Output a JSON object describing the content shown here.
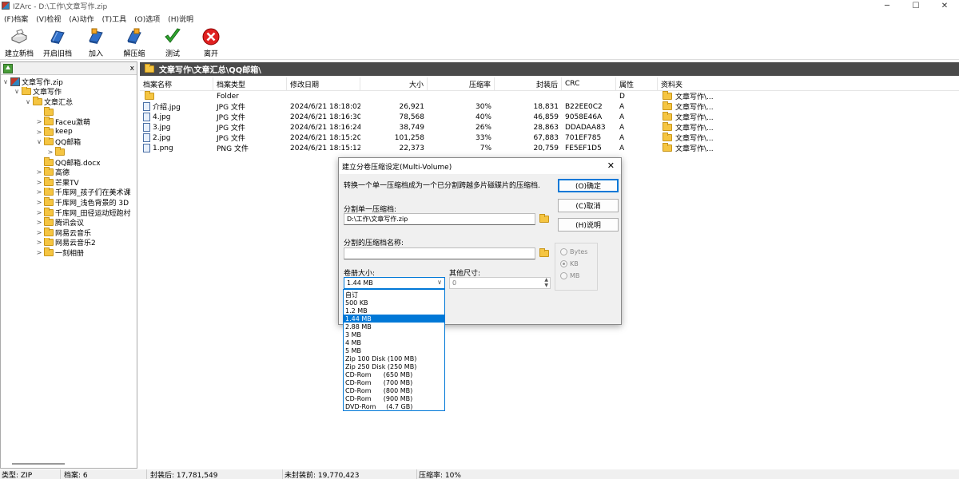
{
  "window": {
    "title": "IZArc - D:\\工作\\文章写作.zip",
    "controls": [
      "─",
      "☐",
      "✕"
    ]
  },
  "menu": [
    "(F)档案",
    "(V)检视",
    "(A)动作",
    "(T)工具",
    "(O)选项",
    "(H)说明"
  ],
  "toolbar": [
    {
      "label": "建立新档",
      "icon": "new-archive-icon"
    },
    {
      "label": "开启旧档",
      "icon": "open-archive-icon"
    },
    {
      "label": "加入",
      "icon": "add-icon"
    },
    {
      "label": "解压缩",
      "icon": "extract-icon"
    },
    {
      "label": "测试",
      "icon": "check-icon"
    },
    {
      "label": "离开",
      "icon": "exit-icon"
    }
  ],
  "left_pane": {
    "close": "x"
  },
  "tree": [
    {
      "label": "文章写作.zip",
      "level": 0,
      "chev": "∨",
      "type": "zip"
    },
    {
      "label": "文章写作",
      "level": 1,
      "chev": "∨",
      "type": "folder"
    },
    {
      "label": "文章汇总",
      "level": 2,
      "chev": "∨",
      "type": "folder"
    },
    {
      "label": "",
      "level": 3,
      "chev": "",
      "type": "folder"
    },
    {
      "label": "Faceu激萌",
      "level": 3,
      "chev": ">",
      "type": "folder"
    },
    {
      "label": "keep",
      "level": 3,
      "chev": ">",
      "type": "folder"
    },
    {
      "label": "QQ邮箱",
      "level": 3,
      "chev": "∨",
      "type": "folder"
    },
    {
      "label": "",
      "level": 4,
      "chev": ">",
      "type": "folder"
    },
    {
      "label": "QQ邮箱.docx",
      "level": 3,
      "chev": "",
      "type": "folder"
    },
    {
      "label": "高德",
      "level": 3,
      "chev": ">",
      "type": "folder"
    },
    {
      "label": "芒果TV",
      "level": 3,
      "chev": ">",
      "type": "folder"
    },
    {
      "label": "千库网_孩子们在美术课",
      "level": 3,
      "chev": ">",
      "type": "folder"
    },
    {
      "label": "千库网_浅色背景的 3D",
      "level": 3,
      "chev": ">",
      "type": "folder"
    },
    {
      "label": "千库网_田径运动短跑村",
      "level": 3,
      "chev": ">",
      "type": "folder"
    },
    {
      "label": "腾讯会议",
      "level": 3,
      "chev": ">",
      "type": "folder"
    },
    {
      "label": "网易云音乐",
      "level": 3,
      "chev": ">",
      "type": "folder"
    },
    {
      "label": "网易云音乐2",
      "level": 3,
      "chev": ">",
      "type": "folder"
    },
    {
      "label": "一刻相册",
      "level": 3,
      "chev": ">",
      "type": "folder"
    }
  ],
  "path": "文章写作\\文章汇总\\QQ邮箱\\",
  "columns": {
    "name": "档案名称",
    "type": "档案类型",
    "date": "修改日期",
    "size": "大小",
    "ratio": "压缩率",
    "packed": "封装后",
    "crc": "CRC",
    "attr": "属性",
    "folder": "资料夹"
  },
  "files": [
    {
      "name": "",
      "type": "Folder",
      "date": "",
      "size": "",
      "ratio": "",
      "packed": "",
      "crc": "",
      "attr": "D",
      "folder": "文章写作\\...",
      "is_folder": true
    },
    {
      "name": "介绍.jpg",
      "type": "JPG 文件",
      "date": "2024/6/21 18:18:02",
      "size": "26,921",
      "ratio": "30%",
      "packed": "18,831",
      "crc": "B22EE0C2",
      "attr": "A",
      "folder": "文章写作\\..."
    },
    {
      "name": "4.jpg",
      "type": "JPG 文件",
      "date": "2024/6/21 18:16:30",
      "size": "78,568",
      "ratio": "40%",
      "packed": "46,859",
      "crc": "9058E46A",
      "attr": "A",
      "folder": "文章写作\\..."
    },
    {
      "name": "3.jpg",
      "type": "JPG 文件",
      "date": "2024/6/21 18:16:24",
      "size": "38,749",
      "ratio": "26%",
      "packed": "28,863",
      "crc": "DDADAA83",
      "attr": "A",
      "folder": "文章写作\\..."
    },
    {
      "name": "2.jpg",
      "type": "JPG 文件",
      "date": "2024/6/21 18:15:20",
      "size": "101,258",
      "ratio": "33%",
      "packed": "67,883",
      "crc": "701EF785",
      "attr": "A",
      "folder": "文章写作\\..."
    },
    {
      "name": "1.png",
      "type": "PNG 文件",
      "date": "2024/6/21 18:15:12",
      "size": "22,373",
      "ratio": "7%",
      "packed": "20,759",
      "crc": "FE5EF1D5",
      "attr": "A",
      "folder": "文章写作\\..."
    }
  ],
  "status": {
    "type": "类型: ZIP",
    "count": "档案: 6",
    "packed": "封装后: 17,781,549",
    "unpacked": "未封装前: 19,770,423",
    "ratio": "压缩率: 10%"
  },
  "dialog": {
    "title": "建立分卷压缩设定(Multi-Volume)",
    "close": "✕",
    "description": "转换一个单一压缩档成为一个已分割跨越多片磁碟片的压缩档.",
    "ok": "(O)确定",
    "cancel": "(C)取消",
    "help": "(H)说明",
    "split_label": "分割单一压缩档:",
    "split_value": "D:\\工作\\文章写作.zip",
    "name_label": "分割的压缩档名称:",
    "name_value": "",
    "volume_label": "卷册大小:",
    "volume_value": "1.44 MB",
    "other_label": "其他尺寸:",
    "other_value": "0",
    "units": [
      {
        "label": "Bytes",
        "checked": false
      },
      {
        "label": "KB",
        "checked": true
      },
      {
        "label": "MB",
        "checked": false
      }
    ],
    "volume_options": [
      "自订",
      "500 KB",
      "1.2 MB",
      "1.44 MB",
      "2.88 MB",
      "3 MB",
      "4 MB",
      "5 MB",
      "Zip 100 Disk (100 MB)",
      "Zip 250 Disk (250 MB)",
      "CD-Rom      (650 MB)",
      "CD-Rom      (700 MB)",
      "CD-Rom      (800 MB)",
      "CD-Rom      (900 MB)",
      "DVD-Rom     (4.7 GB)"
    ],
    "volume_selected": "1.44 MB"
  }
}
